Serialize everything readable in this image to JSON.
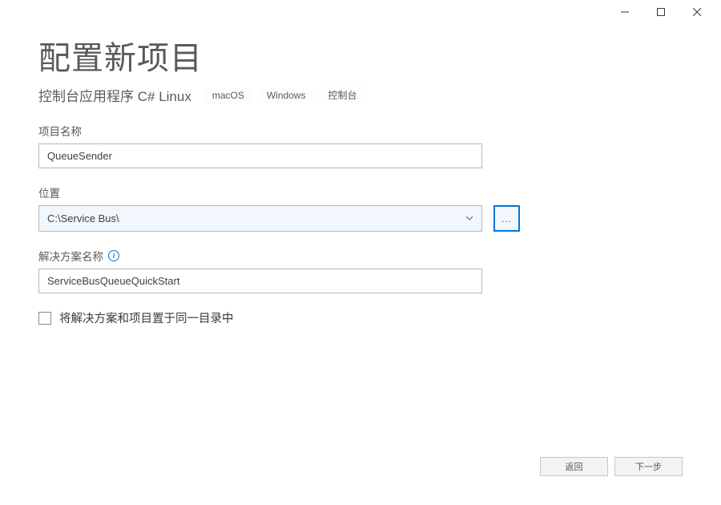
{
  "header": {
    "title": "配置新项目",
    "subtitle": "控制台应用程序",
    "lang_tags": [
      "C#",
      "Linux"
    ],
    "platform_tags": [
      "macOS",
      "Windows",
      "控制台"
    ]
  },
  "fields": {
    "project_name": {
      "label": "项目名称",
      "value": "QueueSender"
    },
    "location": {
      "label": "位置",
      "value": "C:\\Service Bus\\",
      "browse": "..."
    },
    "solution_name": {
      "label": "解决方案名称",
      "value": "ServiceBusQueueQuickStart"
    },
    "same_dir": {
      "label": "将解决方案和项目置于同一目录中",
      "checked": false
    }
  },
  "footer": {
    "back": "返回",
    "next": "下一步"
  }
}
